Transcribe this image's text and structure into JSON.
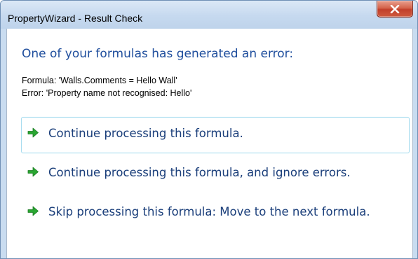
{
  "window": {
    "title": "PropertyWizard - Result Check",
    "close_icon": "close-x-icon"
  },
  "dialog": {
    "main_instruction": "One of your formulas has generated an error:",
    "formula_line": "Formula: 'Walls.Comments = Hello Wall'",
    "error_line": "Error: 'Property name not recognised: Hello'"
  },
  "options": [
    {
      "label": "Continue processing this formula.",
      "icon": "green-arrow-icon",
      "hovered": true
    },
    {
      "label": "Continue processing this formula, and ignore errors.",
      "icon": "green-arrow-icon",
      "hovered": false
    },
    {
      "label": "Skip processing this formula: Move to the next formula.",
      "icon": "green-arrow-icon",
      "hovered": false
    }
  ],
  "colors": {
    "instruction_text": "#1f4e9d",
    "link_text": "#1a3e7a",
    "arrow_green": "#2aa632",
    "hover_border": "#a7dcef",
    "close_red": "#c1402a"
  }
}
